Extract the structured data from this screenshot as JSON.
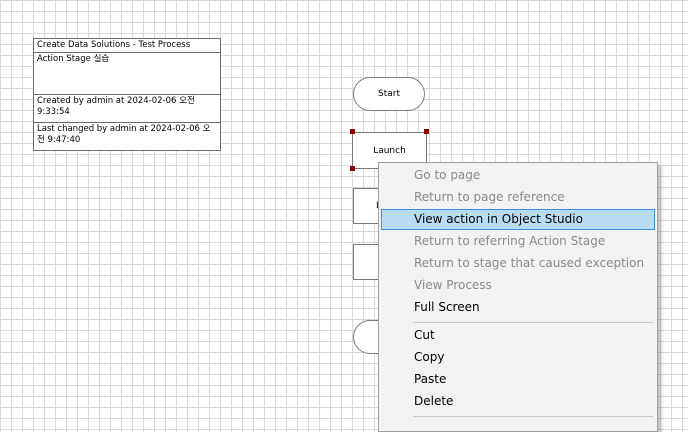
{
  "info_box": {
    "title": "Create Data Solutions - Test Process",
    "description": "Action  Stage 실습",
    "created": "Created  by  admin  at  2024-02-06 오전 9:33:54",
    "last_changed": "Last changed by admin at 2024-02-06 오전 9:47:40"
  },
  "stages": {
    "start": "Start",
    "launch": "Launch",
    "stage3_partial": "L"
  },
  "context_menu": {
    "items": [
      {
        "label": "Go to page",
        "state": "disabled"
      },
      {
        "label": "Return to page reference",
        "state": "disabled"
      },
      {
        "label": "View action in Object Studio",
        "state": "highlighted"
      },
      {
        "label": "Return to referring Action Stage",
        "state": "disabled"
      },
      {
        "label": "Return to stage that caused exception",
        "state": "disabled"
      },
      {
        "label": "View Process",
        "state": "disabled"
      },
      {
        "label": "Full Screen",
        "state": "enabled"
      },
      {
        "label": "Cut",
        "state": "enabled"
      },
      {
        "label": "Copy",
        "state": "enabled"
      },
      {
        "label": "Paste",
        "state": "enabled"
      },
      {
        "label": "Delete",
        "state": "enabled"
      }
    ]
  },
  "colors": {
    "highlight_bg": "#b9dcf5",
    "highlight_border": "#3a8fd8",
    "selection_handle": "#8b0000",
    "disabled_text": "#8a8a8a"
  }
}
